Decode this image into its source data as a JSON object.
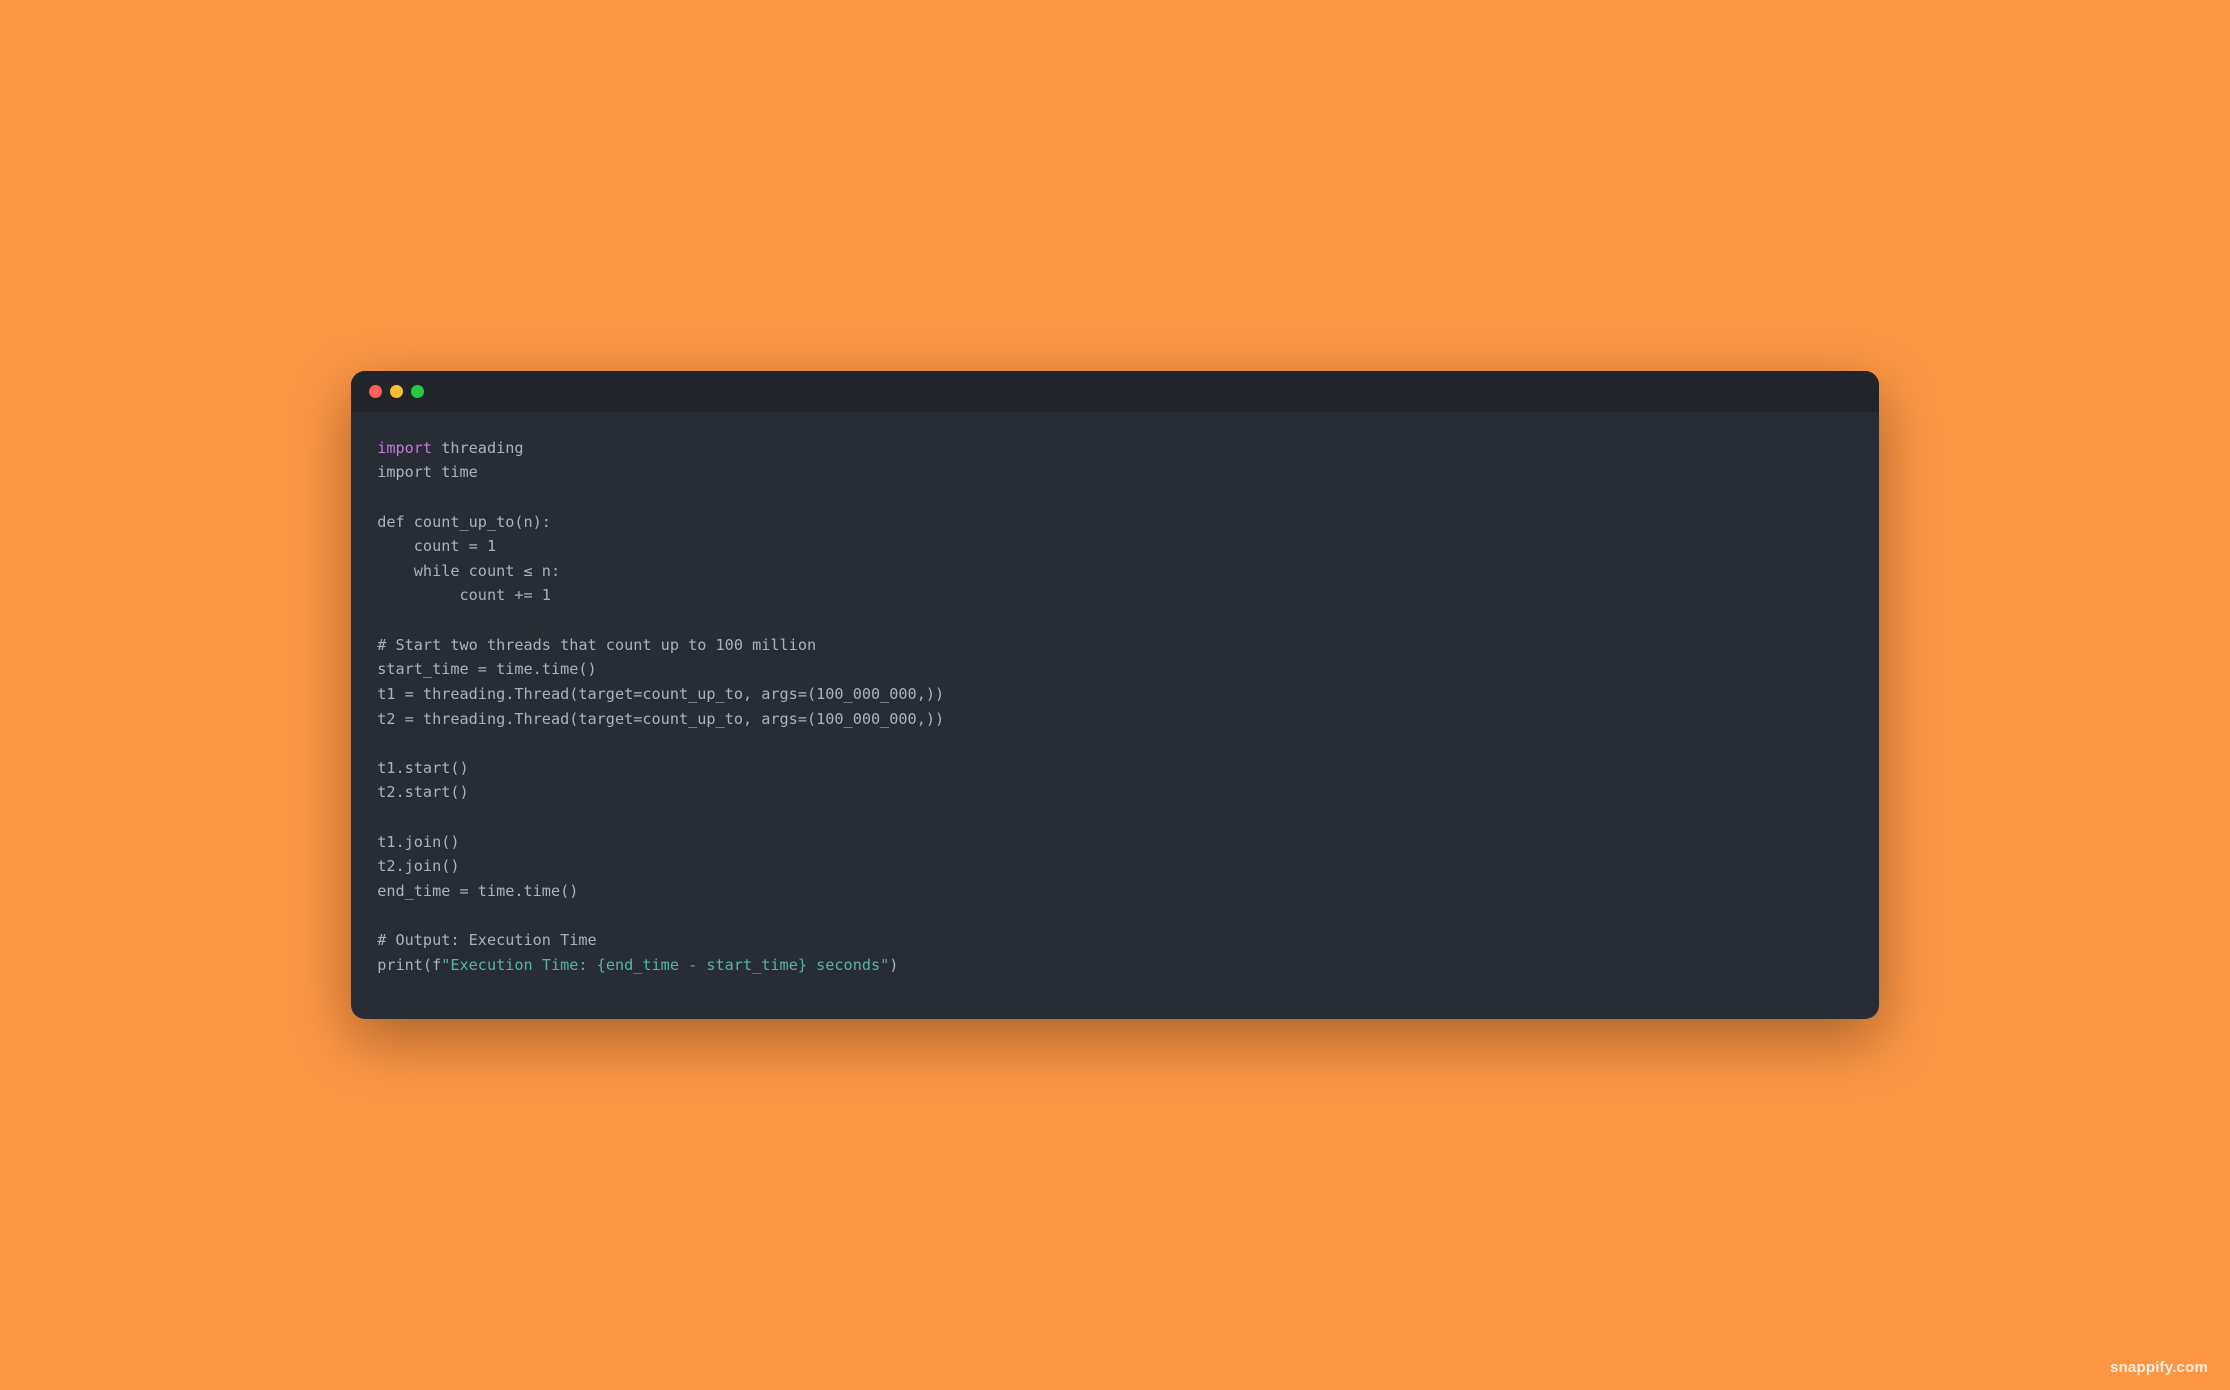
{
  "code": {
    "lines": [
      {
        "segments": [
          {
            "t": "import",
            "c": "kw"
          },
          {
            "t": " threading",
            "c": ""
          }
        ]
      },
      {
        "segments": [
          {
            "t": "import time",
            "c": ""
          }
        ]
      },
      {
        "segments": [
          {
            "t": "",
            "c": ""
          }
        ]
      },
      {
        "segments": [
          {
            "t": "def count_up_to(n):",
            "c": ""
          }
        ]
      },
      {
        "segments": [
          {
            "t": "    count = 1",
            "c": ""
          }
        ]
      },
      {
        "segments": [
          {
            "t": "    while count ≤ n:",
            "c": ""
          }
        ]
      },
      {
        "segments": [
          {
            "t": "         count += 1",
            "c": ""
          }
        ]
      },
      {
        "segments": [
          {
            "t": "",
            "c": ""
          }
        ]
      },
      {
        "segments": [
          {
            "t": "# Start two threads that count up to 100 million",
            "c": ""
          }
        ]
      },
      {
        "segments": [
          {
            "t": "start_time = time.time()",
            "c": ""
          }
        ]
      },
      {
        "segments": [
          {
            "t": "t1 = threading.Thread(target=count_up_to, args=(100_000_000,))",
            "c": ""
          }
        ]
      },
      {
        "segments": [
          {
            "t": "t2 = threading.Thread(target=count_up_to, args=(100_000_000,))",
            "c": ""
          }
        ]
      },
      {
        "segments": [
          {
            "t": "",
            "c": ""
          }
        ]
      },
      {
        "segments": [
          {
            "t": "t1.start()",
            "c": ""
          }
        ]
      },
      {
        "segments": [
          {
            "t": "t2.start()",
            "c": ""
          }
        ]
      },
      {
        "segments": [
          {
            "t": "",
            "c": ""
          }
        ]
      },
      {
        "segments": [
          {
            "t": "t1.join()",
            "c": ""
          }
        ]
      },
      {
        "segments": [
          {
            "t": "t2.join()",
            "c": ""
          }
        ]
      },
      {
        "segments": [
          {
            "t": "end_time = time.time()",
            "c": ""
          }
        ]
      },
      {
        "segments": [
          {
            "t": "",
            "c": ""
          }
        ]
      },
      {
        "segments": [
          {
            "t": "# Output: Execution Time",
            "c": ""
          }
        ]
      },
      {
        "segments": [
          {
            "t": "print(f",
            "c": ""
          },
          {
            "t": "\"Execution Time: {end_time - start_time} seconds\"",
            "c": "str"
          },
          {
            "t": ")",
            "c": ""
          }
        ]
      }
    ]
  },
  "watermark": "snappify.com"
}
